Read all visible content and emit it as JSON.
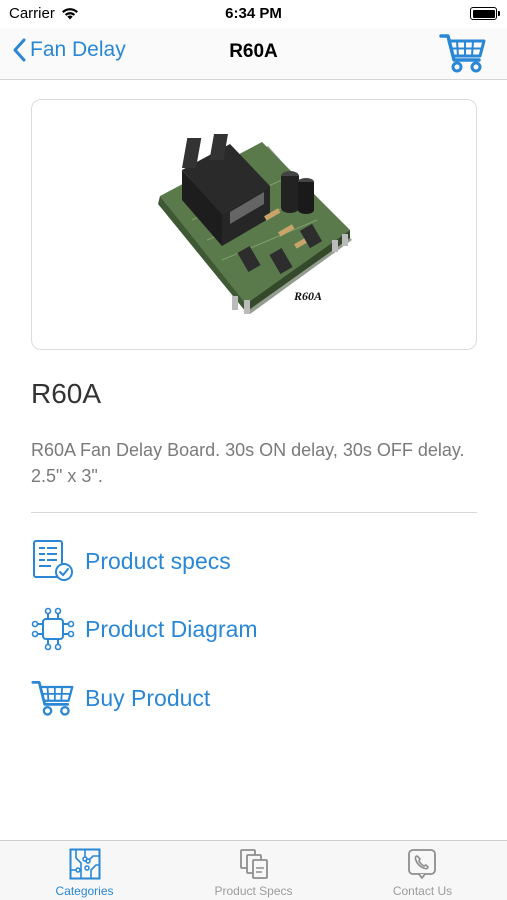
{
  "status_bar": {
    "carrier": "Carrier",
    "time": "6:34 PM"
  },
  "nav": {
    "back_label": "Fan Delay",
    "title": "R60A",
    "cart_icon": "cart-icon"
  },
  "product": {
    "image_label": "R60A",
    "name": "R60A",
    "description": "R60A Fan Delay Board. 30s ON delay, 30s OFF delay. 2.5\" x 3\"."
  },
  "actions": [
    {
      "label": "Product specs",
      "icon": "spec-sheet-icon"
    },
    {
      "label": "Product Diagram",
      "icon": "circuit-chip-icon"
    },
    {
      "label": "Buy Product",
      "icon": "cart-icon"
    }
  ],
  "tabs": [
    {
      "label": "Categories",
      "icon": "circuit-board-icon",
      "active": true
    },
    {
      "label": "Product Specs",
      "icon": "documents-icon",
      "active": false
    },
    {
      "label": "Contact Us",
      "icon": "phone-icon",
      "active": false
    }
  ],
  "colors": {
    "accent": "#2a87d6",
    "text_muted": "#7a7a7a",
    "tab_inactive": "#9b9b9b"
  }
}
